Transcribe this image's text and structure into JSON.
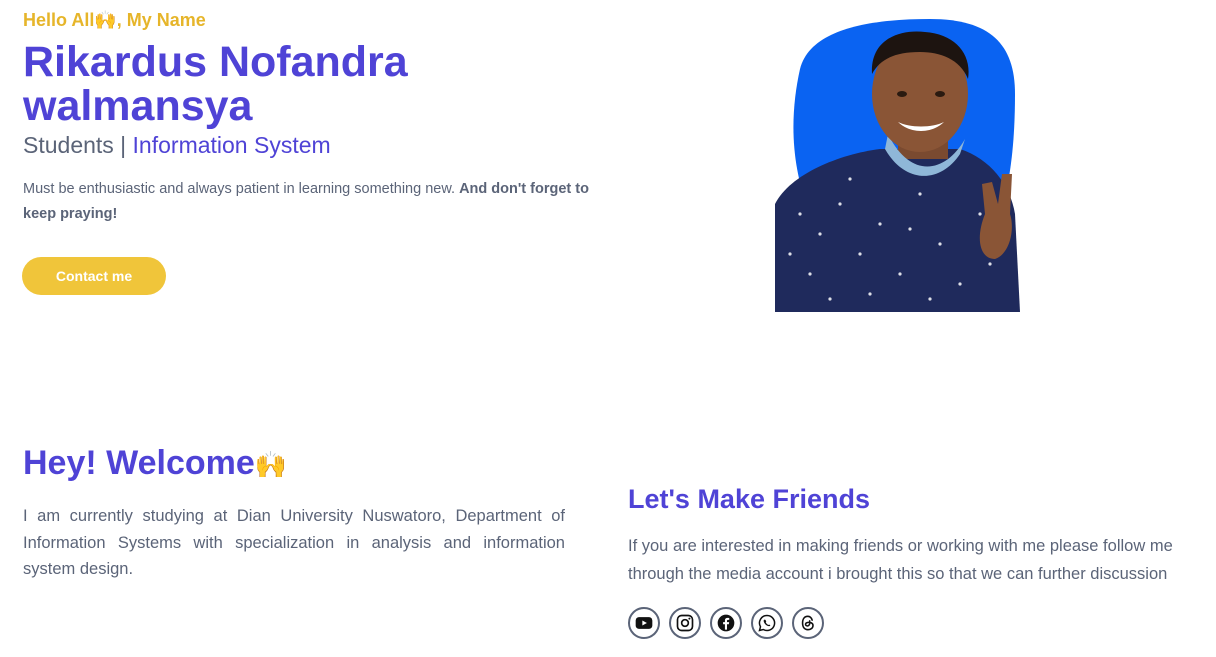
{
  "hero": {
    "greeting": "Hello All🙌, My Name",
    "name": "Rikardus Nofandra walmansya",
    "role_prefix": "Students | ",
    "role_accent": "Information System",
    "intro_text": "Must be enthusiastic and always patient in learning something new. ",
    "intro_bold": "And don't forget to keep praying!",
    "contact_label": "Contact me",
    "blob_color": "#0a63f2",
    "shirt_color": "#1f2a5c"
  },
  "welcome": {
    "title": "Hey! Welcome",
    "emoji": "🙌",
    "text": "I am currently studying at Dian University Nuswatoro, Department of Information Systems with specialization in analysis and information system design."
  },
  "friends": {
    "title": "Let's Make Friends",
    "text": "If you are interested in making friends or working with me please follow me through the media account i brought this so that we can further discussion",
    "socials": [
      "youtube-icon",
      "instagram-icon",
      "facebook-icon",
      "whatsapp-icon",
      "threads-icon"
    ]
  },
  "colors": {
    "primary": "#4f43d6",
    "accent": "#e6b52a",
    "button": "#f0c53a",
    "text": "#5b6478"
  }
}
